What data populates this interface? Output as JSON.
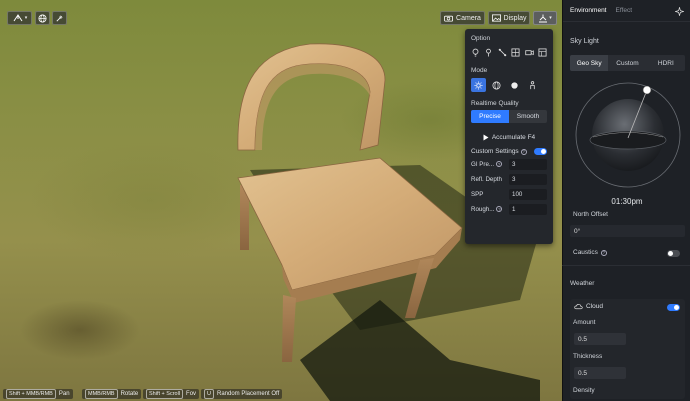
{
  "viewport": {
    "toolbar": {
      "camera_label": "Camera",
      "display_label": "Display"
    },
    "hints": [
      {
        "key": "Shift + MMB/RMB",
        "action": "Pan"
      },
      {
        "key": "MMB/RMB",
        "action": "Rotate"
      },
      {
        "key": "Shift + Scroll",
        "action": "Fov"
      },
      {
        "key": "U",
        "action": "Random Placement Off"
      }
    ]
  },
  "option_panel": {
    "option_title": "Option",
    "mode_title": "Mode",
    "quality_title": "Realtime Quality",
    "quality_options": [
      "Precise",
      "Smooth"
    ],
    "quality_selected": "Precise",
    "accumulate_label": "Accumulate F4",
    "custom_settings_label": "Custom Settings",
    "custom_settings_on": true,
    "params": [
      {
        "label": "GI Pre...",
        "value": "3",
        "help": true
      },
      {
        "label": "Refl. Depth",
        "value": "3",
        "help": false
      },
      {
        "label": "SPP",
        "value": "100",
        "help": false
      },
      {
        "label": "Rough...",
        "value": "1",
        "help": true
      }
    ]
  },
  "right_panel": {
    "tabs": [
      "Environment",
      "Effect"
    ],
    "active_tab": "Environment",
    "sky_light": {
      "title": "Sky Light",
      "options": [
        "Geo Sky",
        "Custom",
        "HDRI"
      ],
      "selected": "Geo Sky",
      "time": "01:30pm",
      "north_offset_label": "North Offset",
      "north_offset_value": "0°",
      "caustics_label": "Caustics",
      "caustics_on": false
    },
    "weather": {
      "title": "Weather",
      "cloud_label": "Cloud",
      "cloud_on": true,
      "amount_label": "Amount",
      "amount_value": "0.5",
      "thickness_label": "Thickness",
      "thickness_value": "0.5",
      "density_label": "Density"
    }
  },
  "colors": {
    "accent": "#2f7bff",
    "panel_bg": "#1e2126"
  }
}
